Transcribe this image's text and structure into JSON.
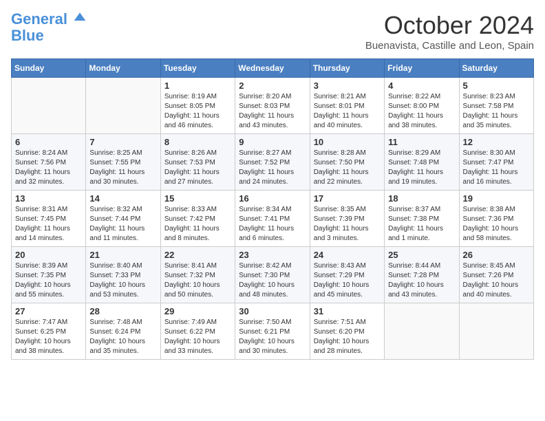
{
  "header": {
    "logo_line1": "General",
    "logo_line2": "Blue",
    "month": "October 2024",
    "location": "Buenavista, Castille and Leon, Spain"
  },
  "weekdays": [
    "Sunday",
    "Monday",
    "Tuesday",
    "Wednesday",
    "Thursday",
    "Friday",
    "Saturday"
  ],
  "weeks": [
    [
      {
        "day": "",
        "info": ""
      },
      {
        "day": "",
        "info": ""
      },
      {
        "day": "1",
        "info": "Sunrise: 8:19 AM\nSunset: 8:05 PM\nDaylight: 11 hours\nand 46 minutes."
      },
      {
        "day": "2",
        "info": "Sunrise: 8:20 AM\nSunset: 8:03 PM\nDaylight: 11 hours\nand 43 minutes."
      },
      {
        "day": "3",
        "info": "Sunrise: 8:21 AM\nSunset: 8:01 PM\nDaylight: 11 hours\nand 40 minutes."
      },
      {
        "day": "4",
        "info": "Sunrise: 8:22 AM\nSunset: 8:00 PM\nDaylight: 11 hours\nand 38 minutes."
      },
      {
        "day": "5",
        "info": "Sunrise: 8:23 AM\nSunset: 7:58 PM\nDaylight: 11 hours\nand 35 minutes."
      }
    ],
    [
      {
        "day": "6",
        "info": "Sunrise: 8:24 AM\nSunset: 7:56 PM\nDaylight: 11 hours\nand 32 minutes."
      },
      {
        "day": "7",
        "info": "Sunrise: 8:25 AM\nSunset: 7:55 PM\nDaylight: 11 hours\nand 30 minutes."
      },
      {
        "day": "8",
        "info": "Sunrise: 8:26 AM\nSunset: 7:53 PM\nDaylight: 11 hours\nand 27 minutes."
      },
      {
        "day": "9",
        "info": "Sunrise: 8:27 AM\nSunset: 7:52 PM\nDaylight: 11 hours\nand 24 minutes."
      },
      {
        "day": "10",
        "info": "Sunrise: 8:28 AM\nSunset: 7:50 PM\nDaylight: 11 hours\nand 22 minutes."
      },
      {
        "day": "11",
        "info": "Sunrise: 8:29 AM\nSunset: 7:48 PM\nDaylight: 11 hours\nand 19 minutes."
      },
      {
        "day": "12",
        "info": "Sunrise: 8:30 AM\nSunset: 7:47 PM\nDaylight: 11 hours\nand 16 minutes."
      }
    ],
    [
      {
        "day": "13",
        "info": "Sunrise: 8:31 AM\nSunset: 7:45 PM\nDaylight: 11 hours\nand 14 minutes."
      },
      {
        "day": "14",
        "info": "Sunrise: 8:32 AM\nSunset: 7:44 PM\nDaylight: 11 hours\nand 11 minutes."
      },
      {
        "day": "15",
        "info": "Sunrise: 8:33 AM\nSunset: 7:42 PM\nDaylight: 11 hours\nand 8 minutes."
      },
      {
        "day": "16",
        "info": "Sunrise: 8:34 AM\nSunset: 7:41 PM\nDaylight: 11 hours\nand 6 minutes."
      },
      {
        "day": "17",
        "info": "Sunrise: 8:35 AM\nSunset: 7:39 PM\nDaylight: 11 hours\nand 3 minutes."
      },
      {
        "day": "18",
        "info": "Sunrise: 8:37 AM\nSunset: 7:38 PM\nDaylight: 11 hours\nand 1 minute."
      },
      {
        "day": "19",
        "info": "Sunrise: 8:38 AM\nSunset: 7:36 PM\nDaylight: 10 hours\nand 58 minutes."
      }
    ],
    [
      {
        "day": "20",
        "info": "Sunrise: 8:39 AM\nSunset: 7:35 PM\nDaylight: 10 hours\nand 55 minutes."
      },
      {
        "day": "21",
        "info": "Sunrise: 8:40 AM\nSunset: 7:33 PM\nDaylight: 10 hours\nand 53 minutes."
      },
      {
        "day": "22",
        "info": "Sunrise: 8:41 AM\nSunset: 7:32 PM\nDaylight: 10 hours\nand 50 minutes."
      },
      {
        "day": "23",
        "info": "Sunrise: 8:42 AM\nSunset: 7:30 PM\nDaylight: 10 hours\nand 48 minutes."
      },
      {
        "day": "24",
        "info": "Sunrise: 8:43 AM\nSunset: 7:29 PM\nDaylight: 10 hours\nand 45 minutes."
      },
      {
        "day": "25",
        "info": "Sunrise: 8:44 AM\nSunset: 7:28 PM\nDaylight: 10 hours\nand 43 minutes."
      },
      {
        "day": "26",
        "info": "Sunrise: 8:45 AM\nSunset: 7:26 PM\nDaylight: 10 hours\nand 40 minutes."
      }
    ],
    [
      {
        "day": "27",
        "info": "Sunrise: 7:47 AM\nSunset: 6:25 PM\nDaylight: 10 hours\nand 38 minutes."
      },
      {
        "day": "28",
        "info": "Sunrise: 7:48 AM\nSunset: 6:24 PM\nDaylight: 10 hours\nand 35 minutes."
      },
      {
        "day": "29",
        "info": "Sunrise: 7:49 AM\nSunset: 6:22 PM\nDaylight: 10 hours\nand 33 minutes."
      },
      {
        "day": "30",
        "info": "Sunrise: 7:50 AM\nSunset: 6:21 PM\nDaylight: 10 hours\nand 30 minutes."
      },
      {
        "day": "31",
        "info": "Sunrise: 7:51 AM\nSunset: 6:20 PM\nDaylight: 10 hours\nand 28 minutes."
      },
      {
        "day": "",
        "info": ""
      },
      {
        "day": "",
        "info": ""
      }
    ]
  ]
}
